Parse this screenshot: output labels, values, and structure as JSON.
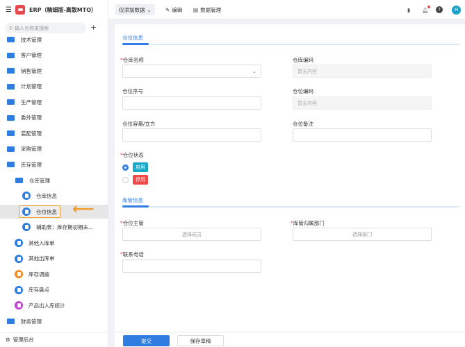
{
  "app": {
    "title": "ERP（精细版-离散MTO）",
    "search_placeholder": "输入名称来搜索"
  },
  "sidebar": {
    "items": [
      "技术管理",
      "客户管理",
      "销售管理",
      "计划管理",
      "生产管理",
      "委外管理",
      "装配管理",
      "采购管理",
      "库存管理"
    ],
    "sub_group": "仓库管理",
    "sub_items": [
      "仓库信息",
      "仓位信息",
      "辅助表：库存期初期末..."
    ],
    "inv_items": [
      {
        "label": "其他入库单",
        "color": "#2f7de1"
      },
      {
        "label": "其他出库单",
        "color": "#2f7de1"
      },
      {
        "label": "库存调拨",
        "color": "#f08a24"
      },
      {
        "label": "库存盘点",
        "color": "#2f7de1"
      },
      {
        "label": "产品出入库统计",
        "color": "#c040d0"
      }
    ],
    "finance": "财务管理",
    "admin": "管理后台"
  },
  "toolbar": {
    "view": "仅添加数据",
    "edit": "编辑",
    "data_manage": "数据管理",
    "avatar": "H"
  },
  "form": {
    "section1": "仓位信息",
    "warehouse_name": "仓库名称",
    "warehouse_code": "仓库编码",
    "no_content": "暂无内容",
    "location_seq": "仓位序号",
    "location_code": "仓位编码",
    "capacity": "仓位容量/立方",
    "remark": "仓位备注",
    "status": "仓位状态",
    "enabled": "启用",
    "disabled": "停用",
    "section2": "库管信息",
    "manager": "仓位主管",
    "select_member": "选择成员",
    "dept": "库管归属部门",
    "select_dept": "选择部门",
    "phone": "联系电话"
  },
  "footer": {
    "submit": "提交",
    "save_draft": "保存草稿"
  }
}
